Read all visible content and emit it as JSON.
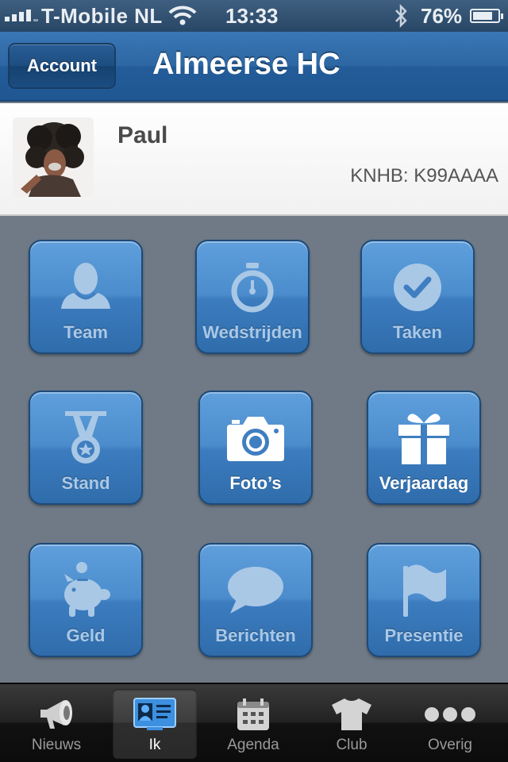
{
  "status_bar": {
    "carrier": "T-Mobile NL",
    "time": "13:33",
    "battery": "76%"
  },
  "nav": {
    "account_label": "Account",
    "title": "Almeerse HC"
  },
  "profile": {
    "name": "Paul",
    "knhb": "KNHB: K99AAAA"
  },
  "tiles": [
    {
      "label": "Team",
      "icon": "person-icon",
      "active": false
    },
    {
      "label": "Wedstrijden",
      "icon": "stopwatch-icon",
      "active": false
    },
    {
      "label": "Taken",
      "icon": "checkmark-icon",
      "active": false
    },
    {
      "label": "Stand",
      "icon": "medal-icon",
      "active": false
    },
    {
      "label": "Foto’s",
      "icon": "camera-icon",
      "active": true
    },
    {
      "label": "Verjaardag",
      "icon": "gift-icon",
      "active": true
    },
    {
      "label": "Geld",
      "icon": "piggy-bank-icon",
      "active": false
    },
    {
      "label": "Berichten",
      "icon": "speech-bubble-icon",
      "active": false
    },
    {
      "label": "Presentie",
      "icon": "flag-icon",
      "active": false
    }
  ],
  "tabs": [
    {
      "label": "Nieuws",
      "icon": "megaphone-icon",
      "selected": false
    },
    {
      "label": "Ik",
      "icon": "id-card-icon",
      "selected": true
    },
    {
      "label": "Agenda",
      "icon": "calendar-icon",
      "selected": false
    },
    {
      "label": "Club",
      "icon": "shirt-icon",
      "selected": false
    },
    {
      "label": "Overig",
      "icon": "more-icon",
      "selected": false
    }
  ],
  "colors": {
    "nav_blue": "#2d67a3",
    "tile_blue": "#4b8ccc",
    "background": "#6f7a86",
    "tab_bar": "#1a1a1a"
  }
}
